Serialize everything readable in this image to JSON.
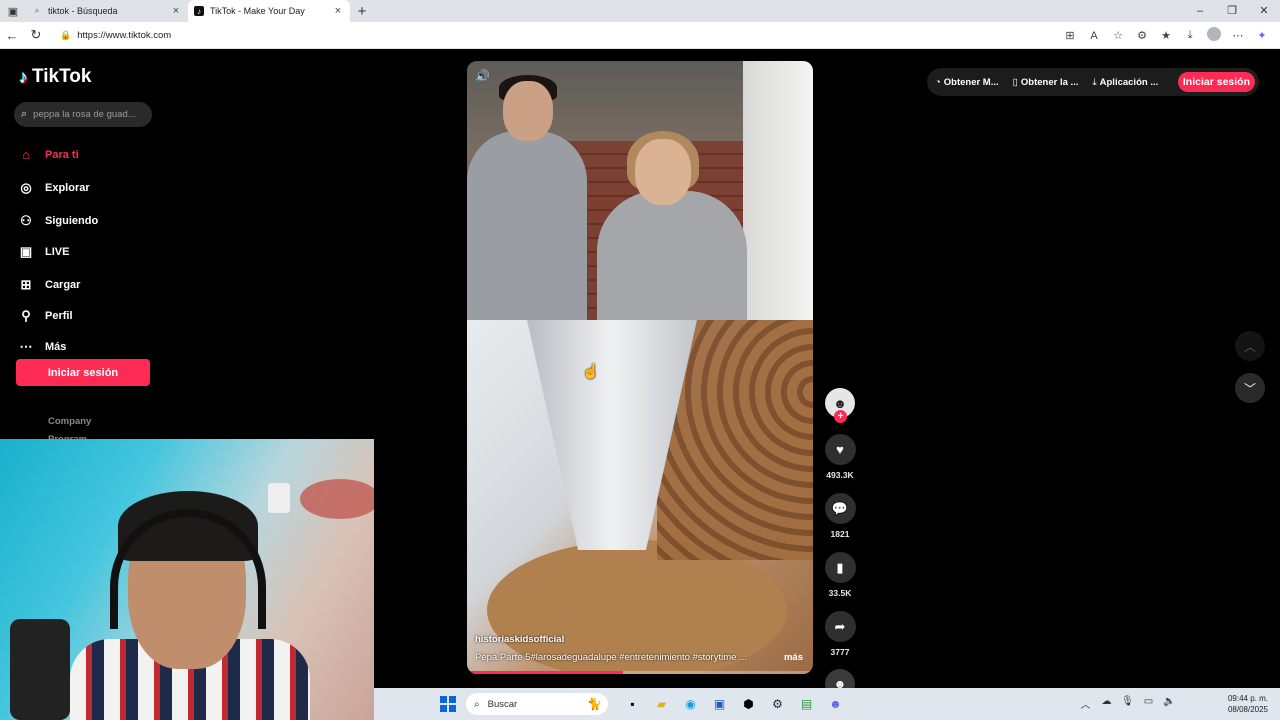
{
  "browser": {
    "tabs": [
      {
        "title": "tiktok - Búsqueda",
        "active": false
      },
      {
        "title": "TikTok - Make Your Day",
        "active": true
      }
    ],
    "url": "https://www.tiktok.com"
  },
  "tiktok": {
    "logo_text": "TikTok",
    "search_placeholder": "peppa la rosa de guad...",
    "nav": [
      {
        "label": "Para ti",
        "icon": "home-icon",
        "active": true
      },
      {
        "label": "Explorar",
        "icon": "compass-icon",
        "active": false
      },
      {
        "label": "Siguiendo",
        "icon": "following-icon",
        "active": false
      },
      {
        "label": "LIVE",
        "icon": "live-icon",
        "active": false
      },
      {
        "label": "Cargar",
        "icon": "upload-icon",
        "active": false
      },
      {
        "label": "Perfil",
        "icon": "profile-icon",
        "active": false
      },
      {
        "label": "Más",
        "icon": "more-icon",
        "active": false
      }
    ],
    "login_label": "Iniciar sesión",
    "footer_links": [
      "Company",
      "Program"
    ],
    "topbar": {
      "items": [
        "Obtener M...",
        "Obtener la ...",
        "Aplicación ..."
      ],
      "login": "Iniciar sesión"
    },
    "video": {
      "author": "historiaskidsofficial",
      "caption": "Pepa Parte 5#larosadeguadalupe #entretenimiento #storytime ...",
      "more": "más",
      "progress": 0.45
    },
    "actions": {
      "likes": "493.3K",
      "comments": "1821",
      "saves": "33.5K",
      "shares": "3777"
    }
  },
  "taskbar": {
    "search_placeholder": "Buscar",
    "time": "09:44 p. m.",
    "date": "08/08/2025"
  },
  "colors": {
    "accent": "#fe2c55",
    "page_bg": "#000000"
  }
}
